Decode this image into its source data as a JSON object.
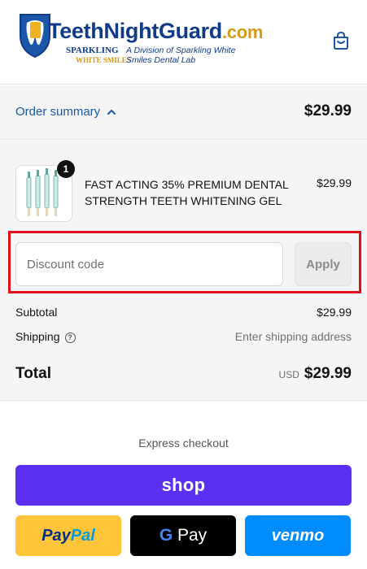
{
  "brand": {
    "name_part1": "TeethNightGuard",
    "name_part2": ".com",
    "sub_line1": "SPARKLING",
    "sub_line2": "WHITE SMILES",
    "division_line1": "A Division of Sparkling White",
    "division_line2": "Smiles Dental Lab",
    "colors": {
      "navy": "#0f3b8a",
      "gold": "#d69a16"
    }
  },
  "header": {
    "cart_icon": "shopping-bag-icon"
  },
  "summary": {
    "toggle_label": "Order summary",
    "total": "$29.99",
    "chevron_icon": "chevron-up-icon"
  },
  "line_item": {
    "quantity": "1",
    "name": "FAST ACTING 35% PREMIUM DENTAL STRENGTH TEETH WHITENING GEL",
    "price": "$29.99"
  },
  "discount": {
    "placeholder": "Discount code",
    "value": "",
    "apply_label": "Apply",
    "highlight_color": "#e10f1c"
  },
  "totals": {
    "subtotal_label": "Subtotal",
    "subtotal_value": "$29.99",
    "shipping_label": "Shipping",
    "shipping_value": "Enter shipping address",
    "total_label": "Total",
    "currency": "USD",
    "total_value": "$29.99"
  },
  "express": {
    "title": "Express checkout",
    "shop_label": "shop",
    "paypal_part1": "Pay",
    "paypal_part2": "Pal",
    "gpay_g": "G",
    "gpay_label": " Pay",
    "venmo_label": "venmo",
    "colors": {
      "shop": "#5a31f4",
      "paypal": "#ffc439",
      "gpay": "#000000",
      "venmo": "#008cff"
    }
  }
}
